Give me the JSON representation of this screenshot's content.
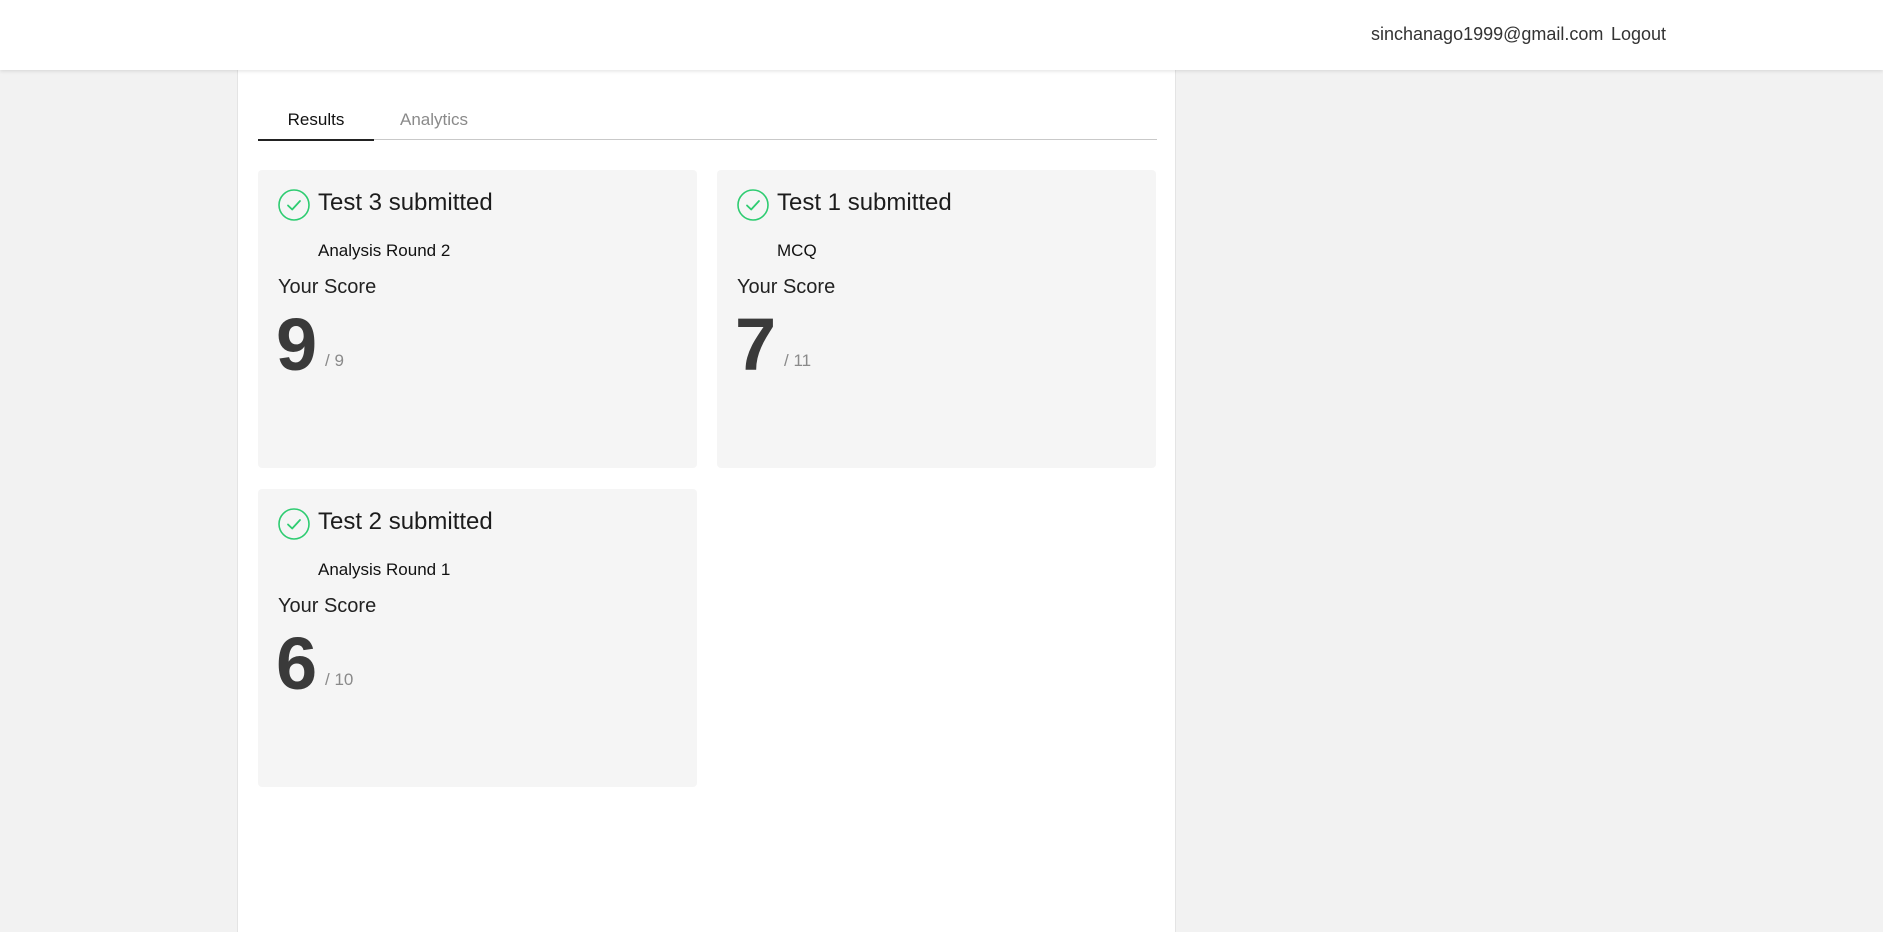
{
  "header": {
    "user_email": "sinchanago1999@gmail.com",
    "logout_label": "Logout"
  },
  "tabs": [
    {
      "label": "Results",
      "active": true
    },
    {
      "label": "Analytics",
      "active": false
    }
  ],
  "results": [
    {
      "title": "Test 3 submitted",
      "subtitle": "Analysis Round 2",
      "score_label": "Your Score",
      "score": "9",
      "total": "/ 9"
    },
    {
      "title": "Test 1 submitted",
      "subtitle": "MCQ",
      "score_label": "Your Score",
      "score": "7",
      "total": "/ 11"
    },
    {
      "title": "Test 2 submitted",
      "subtitle": "Analysis Round 1",
      "score_label": "Your Score",
      "score": "6",
      "total": "/ 10"
    }
  ],
  "icons": {
    "submitted": "check-circle-icon"
  },
  "colors": {
    "success": "#2ecc71",
    "score": "#3a3a3a",
    "card_bg": "#f5f5f5",
    "page_bg": "#f2f2f2"
  }
}
